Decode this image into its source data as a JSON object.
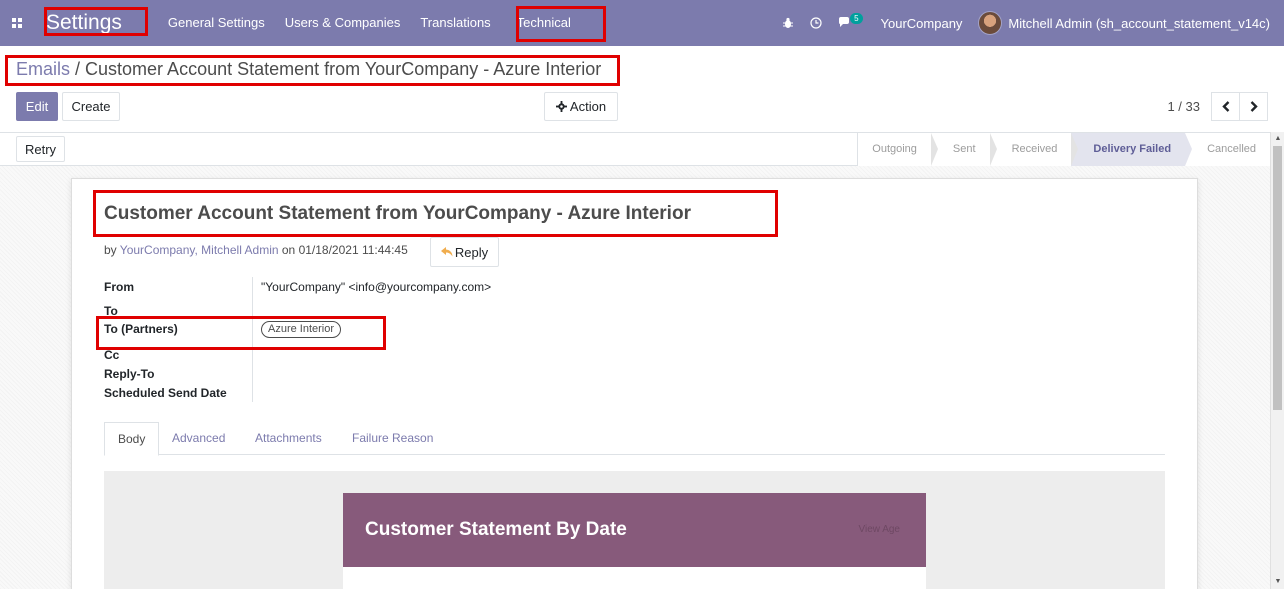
{
  "navbar": {
    "brand": "Settings",
    "menu": [
      "General Settings",
      "Users & Companies",
      "Translations",
      "Technical"
    ],
    "messages_count": "5",
    "company": "YourCompany",
    "user": "Mitchell Admin (sh_account_statement_v14c)"
  },
  "breadcrumb": {
    "parent": "Emails",
    "separator": " / ",
    "current": "Customer Account Statement from YourCompany - Azure Interior"
  },
  "buttons": {
    "edit": "Edit",
    "create": "Create",
    "action": "Action",
    "retry": "Retry"
  },
  "pager": {
    "value": "1 / 33"
  },
  "status_stages": [
    "Outgoing",
    "Sent",
    "Received",
    "Delivery Failed",
    "Cancelled"
  ],
  "status_active": "Delivery Failed",
  "mail": {
    "title": "Customer Account Statement from YourCompany - Azure Interior",
    "by_prefix": "by ",
    "author": "YourCompany, Mitchell Admin",
    "on_prefix": " on ",
    "date": "01/18/2021 11:44:45",
    "reply": "Reply"
  },
  "fields": {
    "from_label": "From",
    "from_value": "\"YourCompany\" <info@yourcompany.com>",
    "to_label": "To",
    "to_partners_label": "To (Partners)",
    "to_partners_tag": "Azure Interior",
    "cc_label": "Cc",
    "reply_to_label": "Reply-To",
    "scheduled_label": "Scheduled Send Date"
  },
  "tabs": [
    "Body",
    "Advanced",
    "Attachments",
    "Failure Reason"
  ],
  "preview": {
    "heading": "Customer Statement By Date",
    "view_link": "View Age"
  },
  "colors": {
    "navbar": "#7c7bad",
    "annotation": "#e00000",
    "mail_header": "#875a7b"
  }
}
